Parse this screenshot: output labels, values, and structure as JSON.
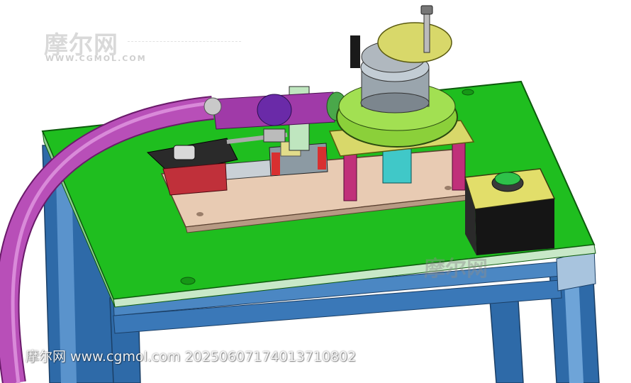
{
  "watermark": {
    "logo": "摩尔网",
    "logo_url": "WWW.CGMOL.COM",
    "mid_logo": "摩尔网",
    "footer": "摩尔网 www.cgmol.com 20250607174013710802"
  },
  "colors": {
    "table_top": "#1fbe1f",
    "frame": "#2f6fae",
    "hose": "#b84fb8",
    "yellow_part": "#d8d86a",
    "base_plate": "#e8cbb3"
  }
}
